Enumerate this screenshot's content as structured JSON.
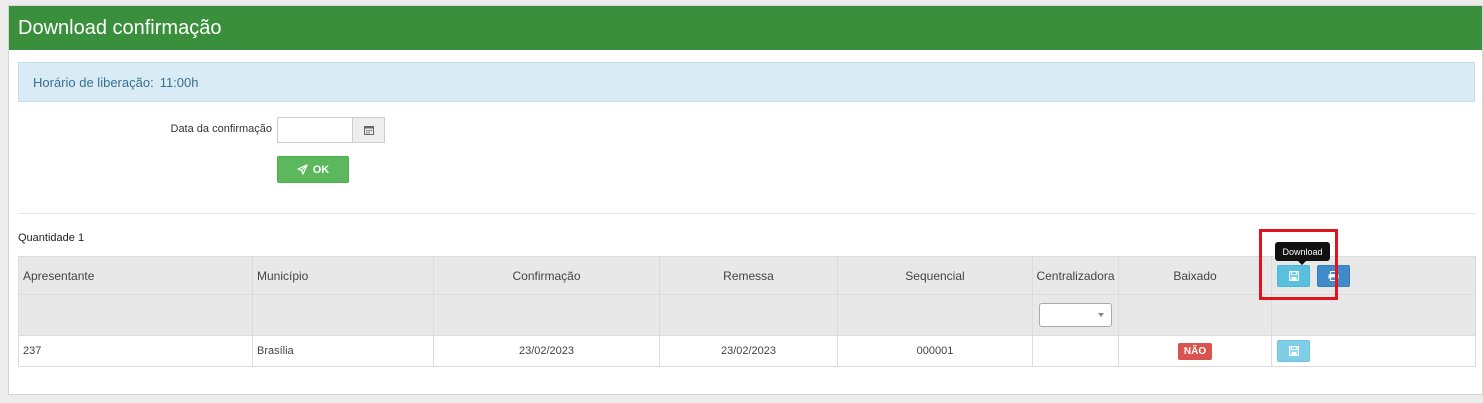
{
  "header": {
    "title": "Download confirmação"
  },
  "info": {
    "label": "Horário de liberação:",
    "value": "11:00h"
  },
  "form": {
    "date_label": "Data da confirmação",
    "date_value": "",
    "ok_label": "OK"
  },
  "count": {
    "label": "Quantidade",
    "value": "1"
  },
  "table": {
    "columns": [
      "Apresentante",
      "Município",
      "Confirmação",
      "Remessa",
      "Sequencial",
      "Centralizadora",
      "Baixado"
    ],
    "rows": [
      {
        "apresentante": "237",
        "municipio": "Brasília",
        "confirmacao": "23/02/2023",
        "remessa": "23/02/2023",
        "sequencial": "000001",
        "centralizadora": "",
        "baixado": "NÃO"
      }
    ]
  },
  "tooltip": {
    "text": "Download"
  },
  "colors": {
    "header": "#3a8f3d",
    "ok": "#5cb85c",
    "badge": "#d9534f",
    "highlight": "#e0141e"
  }
}
